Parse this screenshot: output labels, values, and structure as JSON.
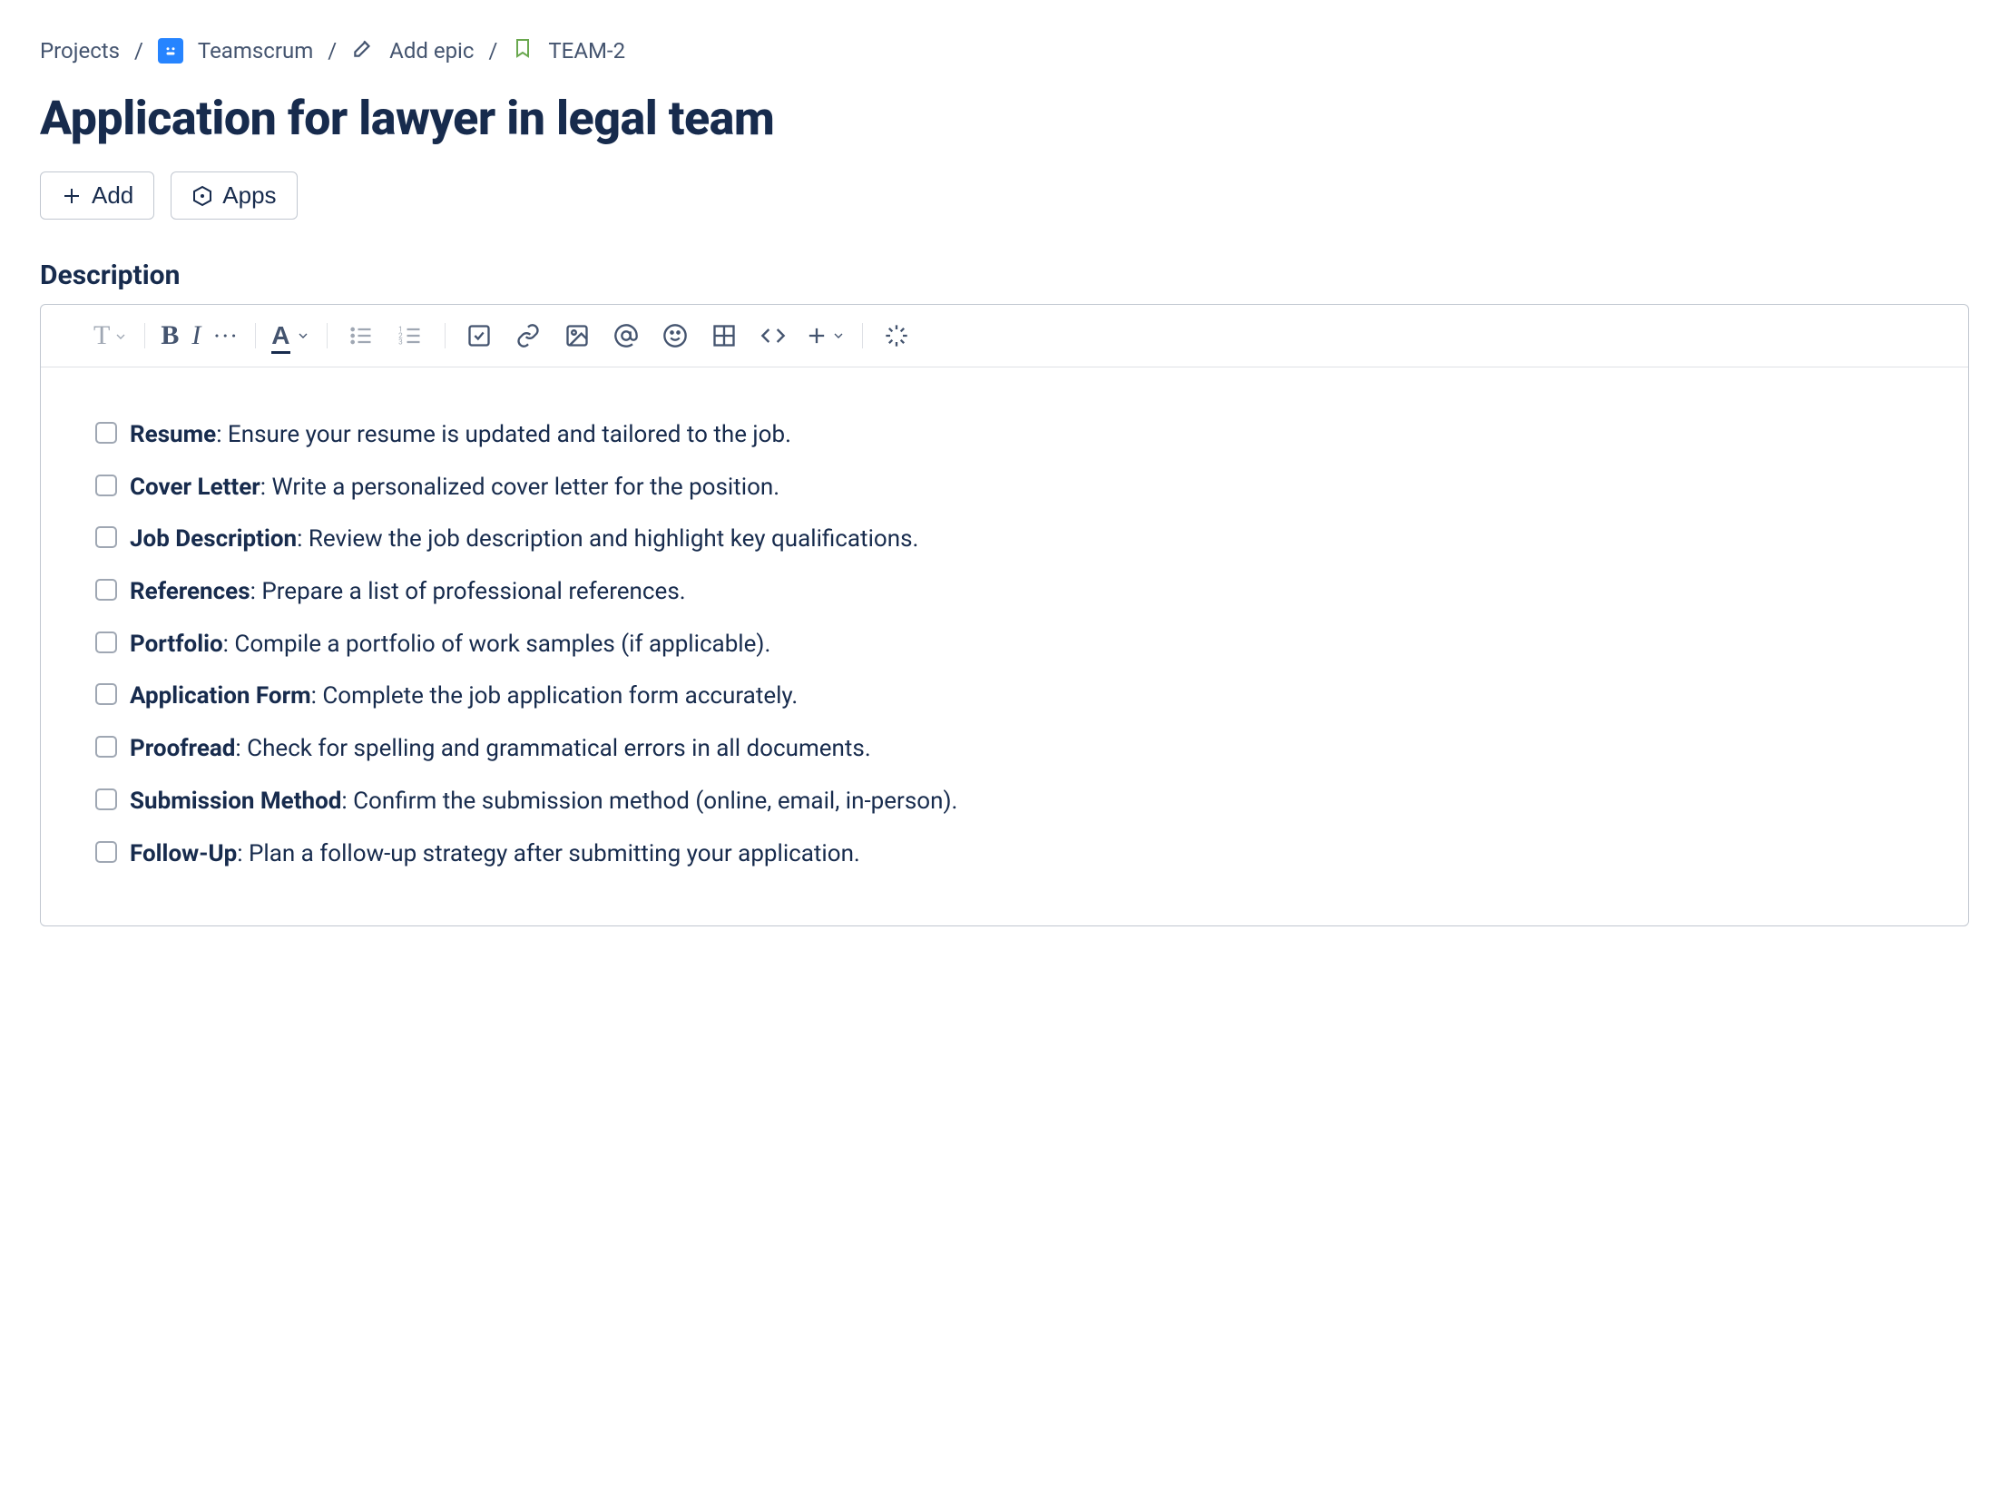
{
  "breadcrumb": {
    "projects": "Projects",
    "project_name": "Teamscrum",
    "add_epic": "Add epic",
    "issue_key": "TEAM-2"
  },
  "title": "Application for lawyer in legal team",
  "buttons": {
    "add": "Add",
    "apps": "Apps"
  },
  "section_description": "Description",
  "checklist": [
    {
      "label": "Resume",
      "text": ": Ensure your resume is updated and tailored to the job."
    },
    {
      "label": "Cover Letter",
      "text": ": Write a personalized cover letter for the position."
    },
    {
      "label": "Job Description",
      "text": ": Review the job description and highlight key qualifications."
    },
    {
      "label": "References",
      "text": ": Prepare a list of professional references."
    },
    {
      "label": "Portfolio",
      "text": ": Compile a portfolio of work samples (if applicable)."
    },
    {
      "label": "Application Form",
      "text": ": Complete the job application form accurately."
    },
    {
      "label": "Proofread",
      "text": ": Check for spelling and grammatical errors in all documents."
    },
    {
      "label": "Submission Method",
      "text": ": Confirm the submission method (online, email, in-person)."
    },
    {
      "label": "Follow-Up",
      "text": ": Plan a follow-up strategy after submitting your application."
    }
  ]
}
